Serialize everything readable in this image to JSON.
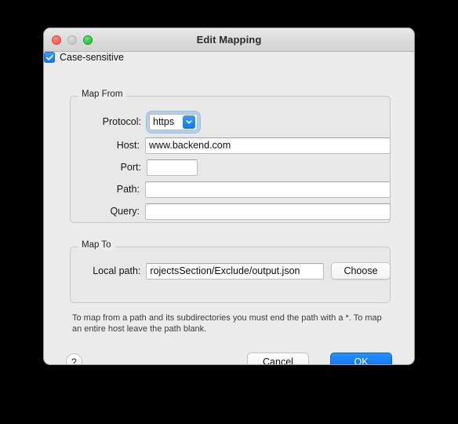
{
  "window": {
    "title": "Edit Mapping",
    "traffic_lights": [
      {
        "name": "close",
        "color": "#ff5f57",
        "enabled": true
      },
      {
        "name": "minimize",
        "color": "#c7c7c7",
        "enabled": false
      },
      {
        "name": "zoom",
        "color": "#28c840",
        "enabled": true
      }
    ]
  },
  "map_from": {
    "legend": "Map From",
    "protocol": {
      "label": "Protocol:",
      "value": "https",
      "arrow_icon": "chevron-down-icon",
      "focused": true
    },
    "host": {
      "label": "Host:",
      "value": "www.backend.com",
      "placeholder": ""
    },
    "port": {
      "label": "Port:",
      "value": "",
      "placeholder": ""
    },
    "path": {
      "label": "Path:",
      "value": "",
      "placeholder": ""
    },
    "query": {
      "label": "Query:",
      "value": "",
      "placeholder": ""
    }
  },
  "map_to": {
    "legend": "Map To",
    "local_path": {
      "label": "Local path:",
      "value": "rojectsSection/Exclude/output.json",
      "placeholder": ""
    },
    "choose_button": "Choose",
    "case_sensitive": {
      "label": "Case-sensitive",
      "checked": true,
      "check_icon": "checkmark-icon",
      "accent": "#0d78ee"
    }
  },
  "help_text": "To map from a path and its subdirectories you must end the path with a *. To map an entire host leave the path blank.",
  "footer": {
    "help_button": "?",
    "cancel_button": "Cancel",
    "ok_button": "OK",
    "ok_accent": "#0a6ef0"
  }
}
